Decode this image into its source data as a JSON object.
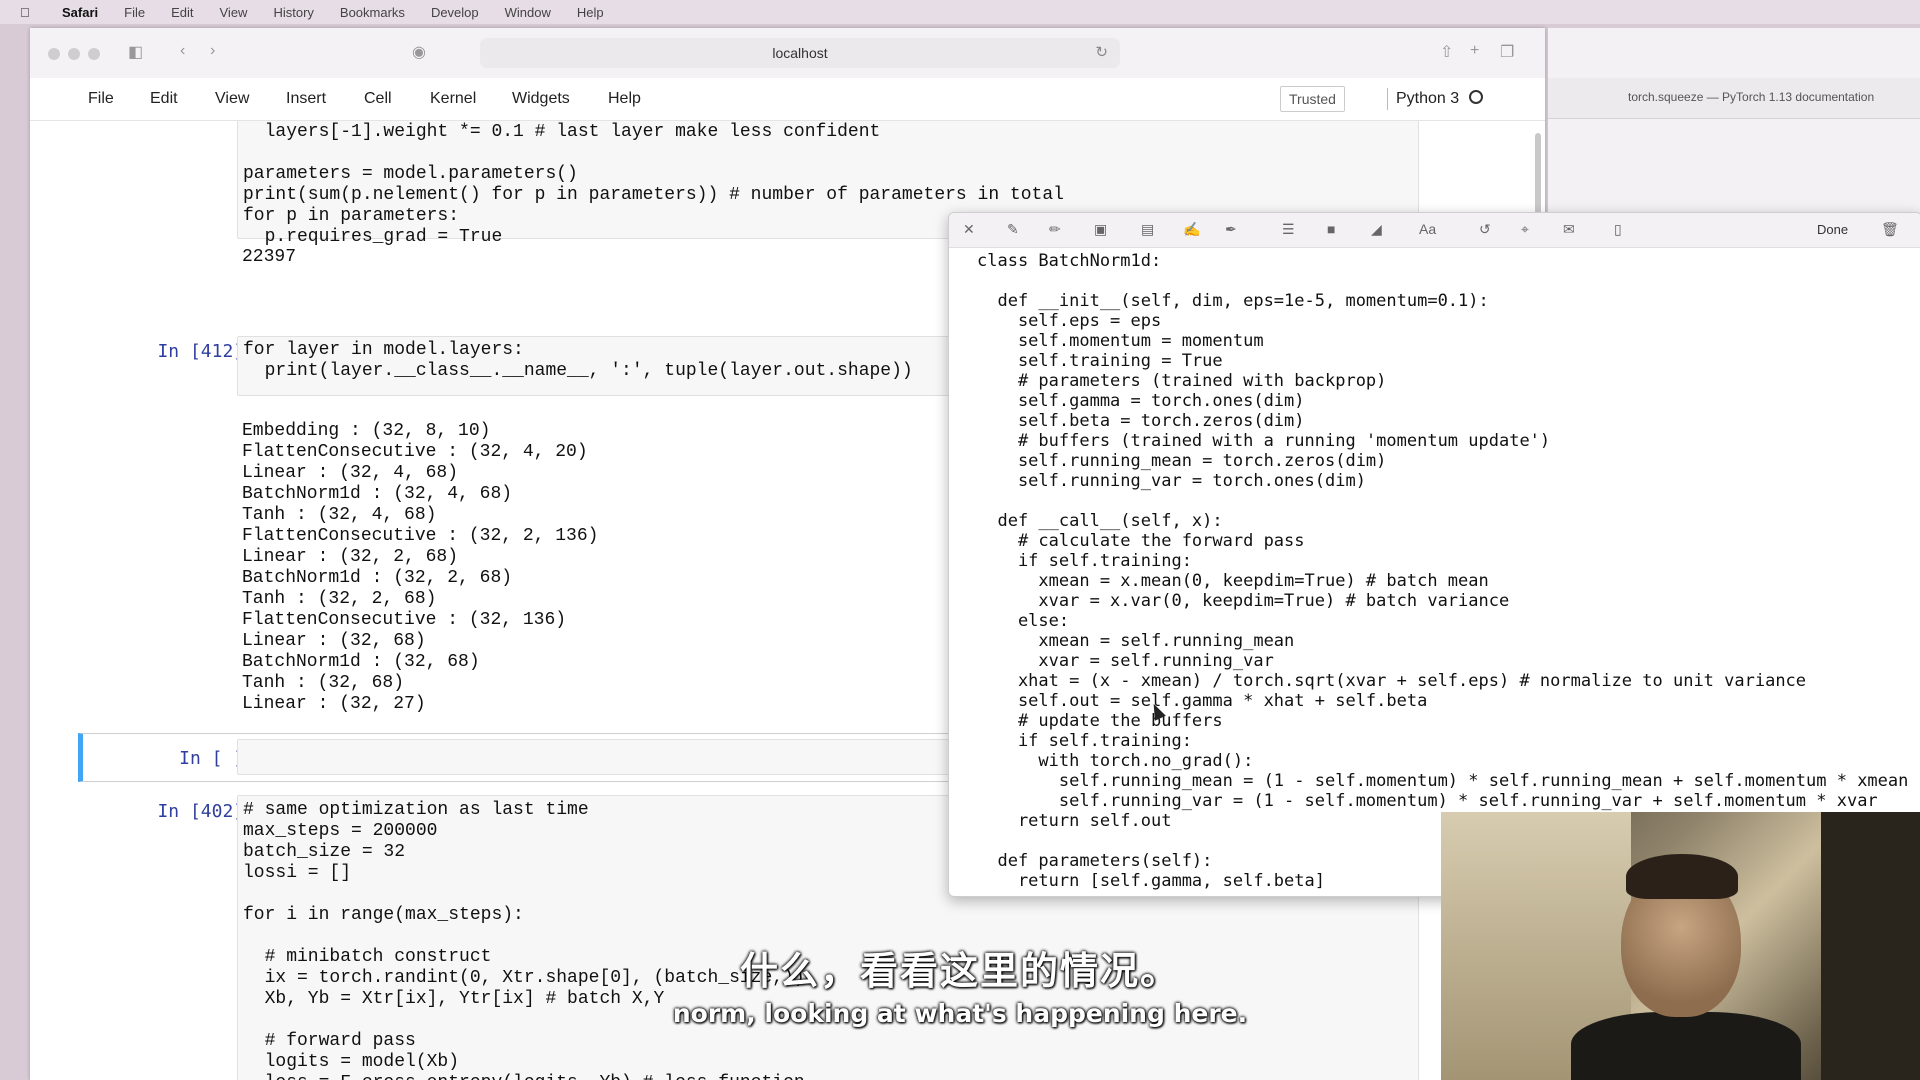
{
  "mac_menu": [
    "Safari",
    "File",
    "Edit",
    "View",
    "History",
    "Bookmarks",
    "Develop",
    "Window",
    "Help"
  ],
  "browser": {
    "url": "localhost"
  },
  "jupyter": {
    "menu": [
      "File",
      "Edit",
      "View",
      "Insert",
      "Cell",
      "Kernel",
      "Widgets",
      "Help"
    ],
    "trusted": "Trusted",
    "kernel": "Python 3"
  },
  "right_pane": {
    "tab_title": "torch.squeeze — PyTorch 1.13 documentation"
  },
  "cells": {
    "c1_code": "  layers[-1].weight *= 0.1 # last layer make less confident\n\nparameters = model.parameters()\nprint(sum(p.nelement() for p in parameters)) # number of parameters in total\nfor p in parameters:\n  p.requires_grad = True",
    "c1_output": "22397",
    "c2_prompt": "In [412]:",
    "c2_code": "for layer in model.layers:\n  print(layer.__class__.__name__, ':', tuple(layer.out.shape))",
    "c2_output": "Embedding : (32, 8, 10)\nFlattenConsecutive : (32, 4, 20)\nLinear : (32, 4, 68)\nBatchNorm1d : (32, 4, 68)\nTanh : (32, 4, 68)\nFlattenConsecutive : (32, 2, 136)\nLinear : (32, 2, 68)\nBatchNorm1d : (32, 2, 68)\nTanh : (32, 2, 68)\nFlattenConsecutive : (32, 136)\nLinear : (32, 68)\nBatchNorm1d : (32, 68)\nTanh : (32, 68)\nLinear : (32, 27)",
    "c3_prompt": "In [ ]:",
    "c4_prompt": "In [402]:",
    "c4_code": "# same optimization as last time\nmax_steps = 200000\nbatch_size = 32\nlossi = []\n\nfor i in range(max_steps):\n\n  # minibatch construct\n  ix = torch.randint(0, Xtr.shape[0], (batch_size,))\n  Xb, Yb = Xtr[ix], Ytr[ix] # batch X,Y\n\n  # forward pass\n  logits = model(Xb)\n  loss = F.cross_entropy(logits, Yb) # loss function"
  },
  "popup": {
    "done": "Done",
    "code": "class BatchNorm1d:\n\n  def __init__(self, dim, eps=1e-5, momentum=0.1):\n    self.eps = eps\n    self.momentum = momentum\n    self.training = True\n    # parameters (trained with backprop)\n    self.gamma = torch.ones(dim)\n    self.beta = torch.zeros(dim)\n    # buffers (trained with a running 'momentum update')\n    self.running_mean = torch.zeros(dim)\n    self.running_var = torch.ones(dim)\n\n  def __call__(self, x):\n    # calculate the forward pass\n    if self.training:\n      xmean = x.mean(0, keepdim=True) # batch mean\n      xvar = x.var(0, keepdim=True) # batch variance\n    else:\n      xmean = self.running_mean\n      xvar = self.running_var\n    xhat = (x - xmean) / torch.sqrt(xvar + self.eps) # normalize to unit variance\n    self.out = self.gamma * xhat + self.beta\n    # update the buffers\n    if self.training:\n      with torch.no_grad():\n        self.running_mean = (1 - self.momentum) * self.running_mean + self.momentum * xmean\n        self.running_var = (1 - self.momentum) * self.running_var + self.momentum * xvar\n    return self.out\n\n  def parameters(self):\n    return [self.gamma, self.beta]"
  },
  "subtitles": {
    "zh": "什么，看看这里的情况。",
    "en": "norm, looking at what's happening here."
  }
}
